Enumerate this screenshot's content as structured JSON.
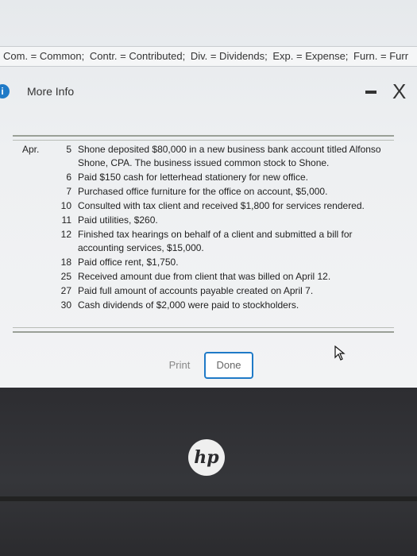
{
  "abbrev_bar": {
    "items": [
      "Com. = Common;",
      "Contr. = Contributed;",
      "Div. = Dividends;",
      "Exp. = Expense;",
      "Furn. = Furr"
    ]
  },
  "dialog": {
    "title": "More Info",
    "info_icon_text": "i",
    "minimize_label": "-",
    "close_label": "X"
  },
  "transactions": [
    {
      "month": "Apr.",
      "day": "5",
      "text": "Shone deposited $80,000 in a new business bank account titled Alfonso Shone, CPA. The business issued common stock to Shone."
    },
    {
      "month": "",
      "day": "6",
      "text": "Paid $150 cash for letterhead stationery for new office."
    },
    {
      "month": "",
      "day": "7",
      "text": "Purchased office furniture for the office on account, $5,000."
    },
    {
      "month": "",
      "day": "10",
      "text": "Consulted with tax client and received $1,800 for services rendered."
    },
    {
      "month": "",
      "day": "11",
      "text": "Paid utilities, $260."
    },
    {
      "month": "",
      "day": "12",
      "text": "Finished tax hearings on behalf of a client and submitted a bill for accounting services, $15,000."
    },
    {
      "month": "",
      "day": "18",
      "text": "Paid office rent, $1,750."
    },
    {
      "month": "",
      "day": "25",
      "text": "Received amount due from client that was billed on April 12."
    },
    {
      "month": "",
      "day": "27",
      "text": "Paid full amount of accounts payable created on April 7."
    },
    {
      "month": "",
      "day": "30",
      "text": "Cash dividends of $2,000 were paid to stockholders."
    }
  ],
  "buttons": {
    "print": "Print",
    "done": "Done"
  },
  "laptop": {
    "brand": "hp"
  },
  "colors": {
    "accent": "#1f7ac7"
  }
}
